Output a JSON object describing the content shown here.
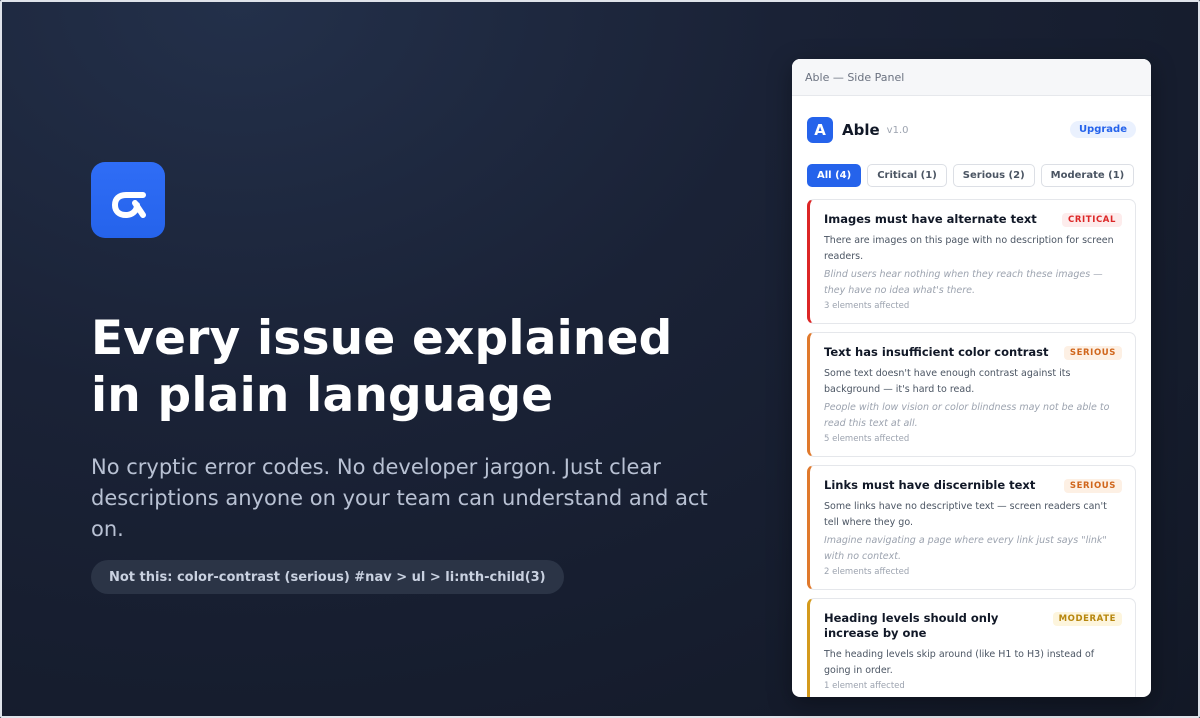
{
  "hero": {
    "logo_icon": "able-logo-icon",
    "headline_line1": "Every issue explained",
    "headline_line2": "in plain language",
    "subhead": "No cryptic error codes. No developer jargon. Just clear descriptions anyone on your team can understand and act on.",
    "not_this": "Not this: color-contrast (serious) #nav > ul > li:nth-child(3)"
  },
  "panel": {
    "window_title": "Able — Side Panel",
    "app_badge": "A",
    "app_name": "Able",
    "app_version": "v1.0",
    "upgrade_label": "Upgrade",
    "filters": [
      {
        "label": "All (4)",
        "active": true
      },
      {
        "label": "Critical (1)",
        "active": false
      },
      {
        "label": "Serious (2)",
        "active": false
      },
      {
        "label": "Moderate (1)",
        "active": false
      }
    ],
    "issues": [
      {
        "title": "Images must have alternate text",
        "severity": "CRITICAL",
        "description": "There are images on this page with no description for screen readers.",
        "impact": "Blind users hear nothing when they reach these images — they have no idea what's there.",
        "count": "3 elements affected"
      },
      {
        "title": "Text has insufficient color contrast",
        "severity": "SERIOUS",
        "description": "Some text doesn't have enough contrast against its background — it's hard to read.",
        "impact": "People with low vision or color blindness may not be able to read this text at all.",
        "count": "5 elements affected"
      },
      {
        "title": "Links must have discernible text",
        "severity": "SERIOUS",
        "description": "Some links have no descriptive text — screen readers can't tell where they go.",
        "impact": "Imagine navigating a page where every link just says \"link\" with no context.",
        "count": "2 elements affected"
      },
      {
        "title": "Heading levels should only increase by one",
        "severity": "MODERATE",
        "description": "The heading levels skip around (like H1 to H3) instead of going in order.",
        "impact": "",
        "count": "1 element affected"
      }
    ]
  },
  "colors": {
    "accent": "#2563eb",
    "critical": "#dc2626",
    "serious": "#e0792c",
    "moderate": "#d49a1c",
    "background": "#1a2236"
  }
}
